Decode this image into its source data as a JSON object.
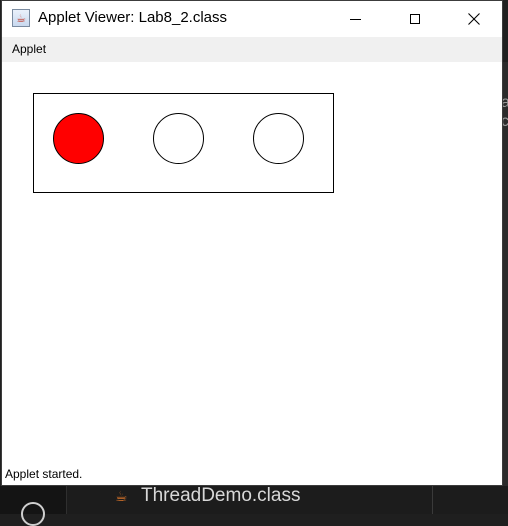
{
  "window": {
    "title": "Applet Viewer: Lab8_2.class",
    "controls": {
      "minimize_icon": "minimize-icon",
      "maximize_icon": "maximize-icon",
      "close_icon": "close-icon"
    }
  },
  "menu": {
    "items": [
      {
        "label": "Applet"
      }
    ]
  },
  "traffic_light": {
    "lamps": [
      {
        "color": "#ff0000",
        "on": true
      },
      {
        "color": "#ffffff",
        "on": false
      },
      {
        "color": "#ffffff",
        "on": false
      }
    ]
  },
  "status": {
    "text": "Applet started."
  },
  "taskbar": {
    "item_label": "ThreadDemo.class"
  },
  "background": {
    "glyph_a": "a",
    "glyph_c": "c"
  }
}
